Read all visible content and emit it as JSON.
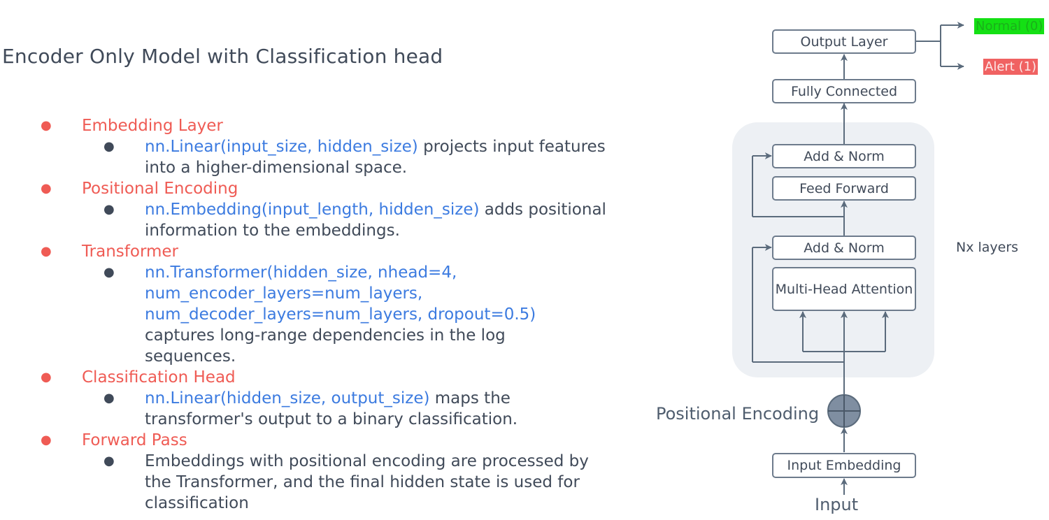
{
  "title": "Encoder Only Model with Classification head",
  "bullets": [
    {
      "heading": "Embedding Layer",
      "code": "nn.Linear(input_size, hidden_size)",
      "text": " projects input features into a higher-dimensional space."
    },
    {
      "heading": "Positional Encoding",
      "code": "nn.Embedding(input_length, hidden_size)",
      "text": " adds positional information to the embeddings."
    },
    {
      "heading": "Transformer",
      "code": "nn.Transformer(hidden_size, nhead=4, num_encoder_layers=num_layers, num_decoder_layers=num_layers, dropout=0.5)",
      "text": " captures long-range dependencies in the log sequences."
    },
    {
      "heading": "Classification Head",
      "code": "nn.Linear(hidden_size, output_size)",
      "text": " maps the transformer's output to a binary classification."
    },
    {
      "heading": "Forward Pass",
      "code": "",
      "text": "Embeddings with positional encoding are processed by the Transformer, and the final hidden state is used for classification"
    }
  ],
  "bullet_symbol": "●",
  "diagram": {
    "output_layer": "Output Layer",
    "fully_connected": "Fully Connected",
    "add_norm_top": "Add & Norm",
    "feed_forward": "Feed Forward",
    "add_norm_bottom": "Add & Norm",
    "multi_head_attention": "Multi-Head Attention",
    "nx_layers": "Nx layers",
    "positional_encoding": "Positional Encoding",
    "input_embedding": "Input Embedding",
    "input": "Input",
    "normal_label": "Normal (0)",
    "alert_label": "Alert (1)"
  },
  "colors": {
    "heading": "#ef5b54",
    "code": "#3c7be0",
    "text": "#404a59",
    "panel": "#edf0f4",
    "line": "#5b6b7c",
    "normal_bg": "#14e014",
    "alert_bg": "#f06262"
  }
}
